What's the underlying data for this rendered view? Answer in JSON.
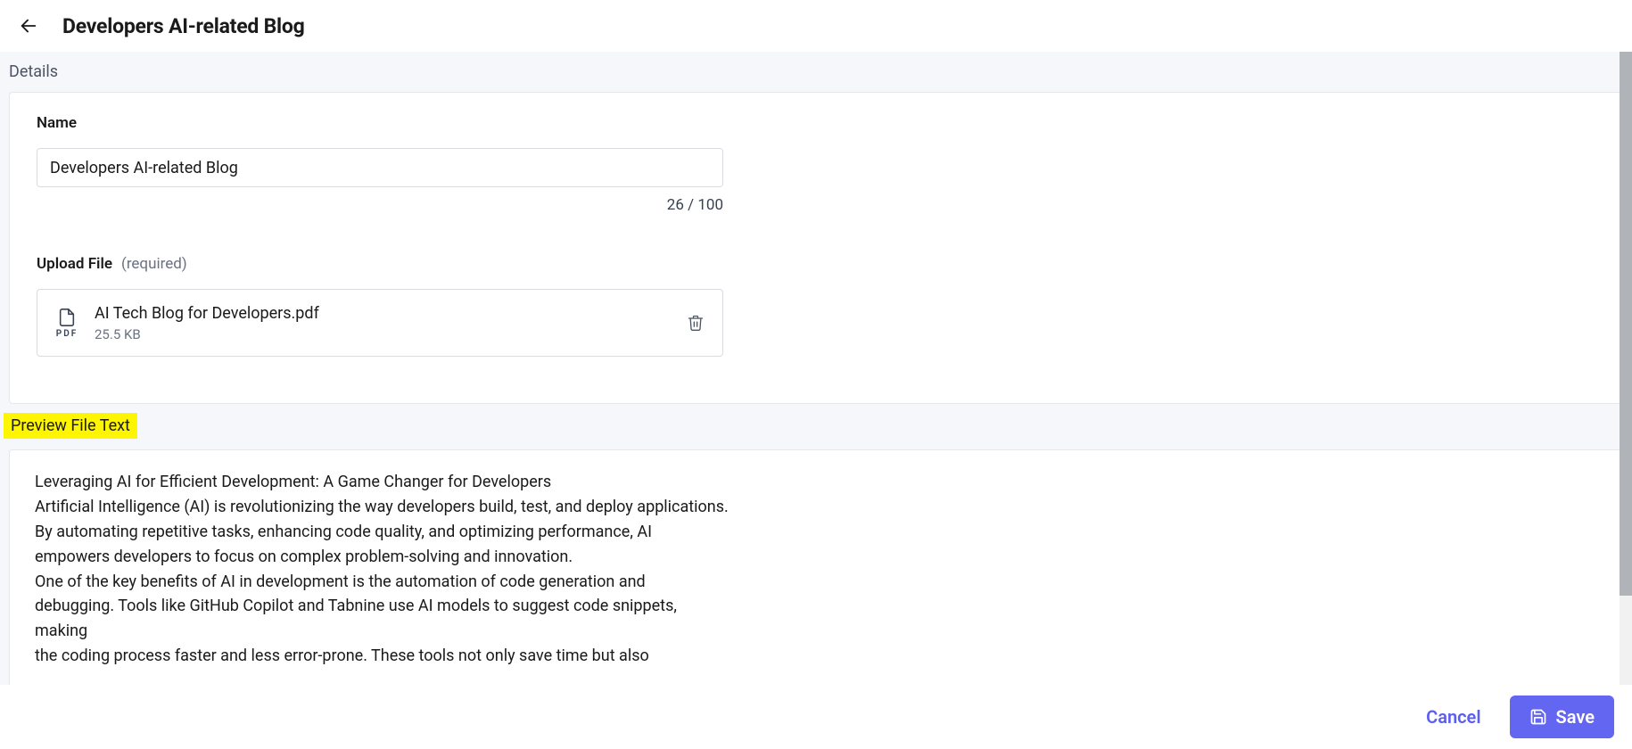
{
  "header": {
    "title": "Developers AI-related Blog"
  },
  "details": {
    "section_label": "Details",
    "name_label": "Name",
    "name_value": "Developers AI-related Blog",
    "char_count": "26 / 100",
    "upload_label": "Upload File",
    "upload_required": "(required)",
    "file": {
      "name": "AI Tech Blog for Developers.pdf",
      "ext": "PDF",
      "size": "25.5 KB"
    }
  },
  "preview": {
    "section_label": "Preview File Text",
    "text": "Leveraging AI for Efficient Development: A Game Changer for Developers\nArtificial Intelligence (AI) is revolutionizing the way developers build, test, and deploy applications. By automating repetitive tasks, enhancing code quality, and optimizing performance, AI empowers developers to focus on complex problem-solving and innovation.\nOne of the key benefits of AI in development is the automation of code generation and debugging. Tools like GitHub Copilot and Tabnine use AI models to suggest code snippets, making\nthe coding process faster and less error-prone. These tools not only save time but also"
  },
  "footer": {
    "cancel_label": "Cancel",
    "save_label": "Save"
  }
}
